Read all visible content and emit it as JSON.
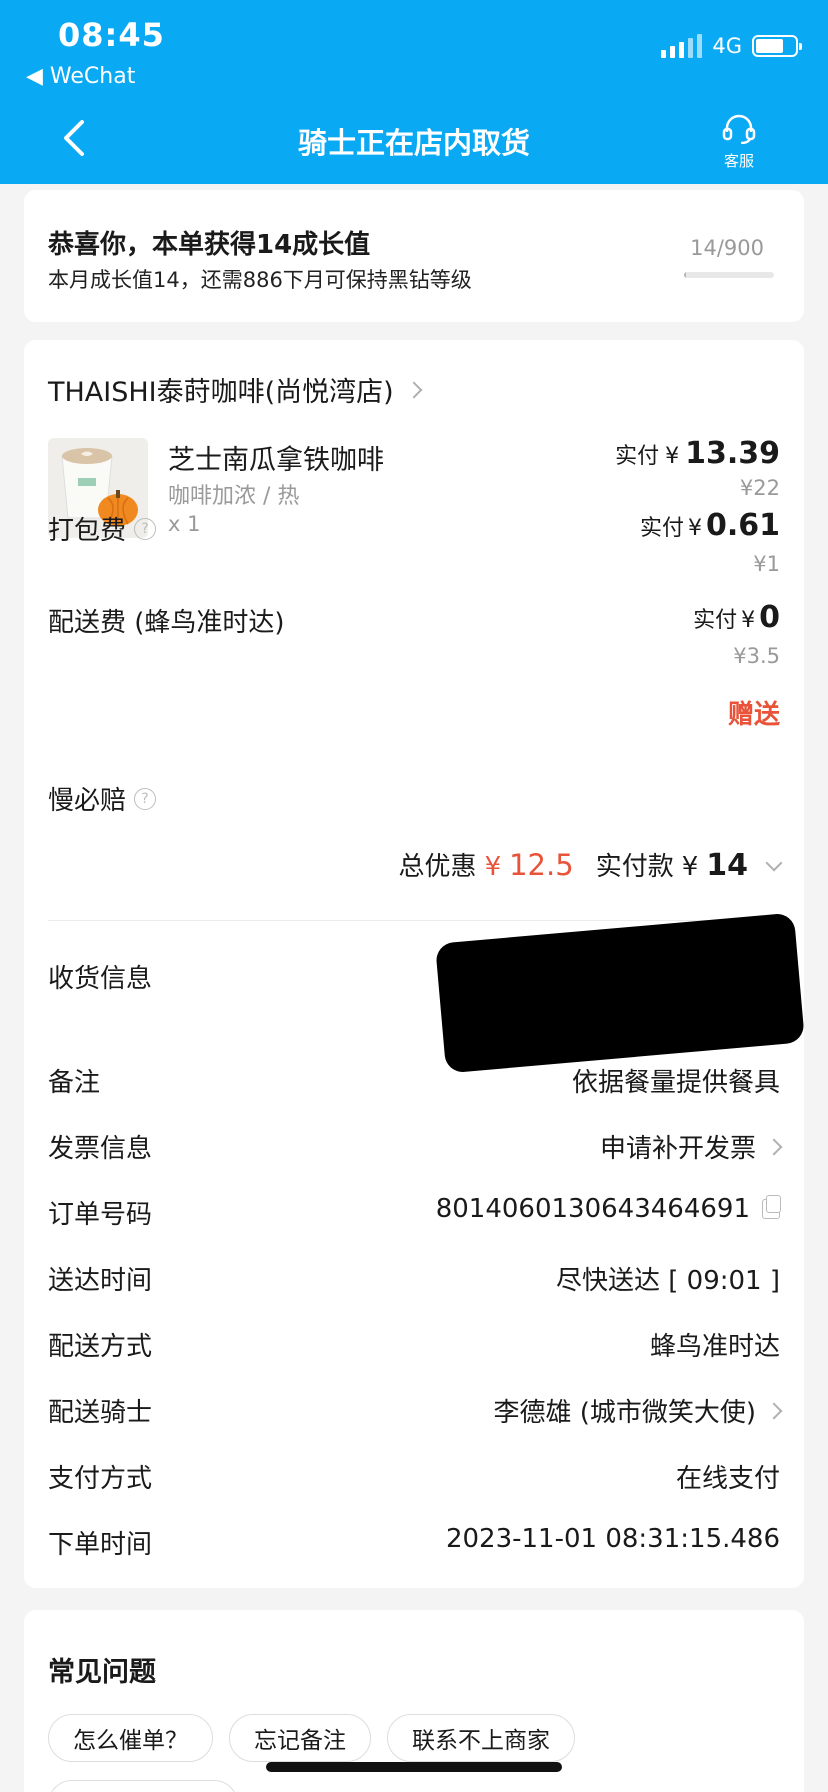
{
  "status_bar": {
    "time": "08:45",
    "back_app": "◀ WeChat",
    "network": "4G",
    "battery_level": 0.7
  },
  "nav": {
    "title": "骑士正在店内取货",
    "service_label": "客服"
  },
  "growth": {
    "title": "恭喜你，本单获得14成长值",
    "subtitle": "本月成长值14，还需886下月可保持黑钻等级",
    "count": "14/900",
    "progress": 0.0156
  },
  "order": {
    "store_name": "THAISHI泰莳咖啡(尚悦湾店)",
    "product": {
      "name": "芝士南瓜拿铁咖啡",
      "spec": "咖啡加浓 / 热",
      "qty": "x 1",
      "paid_label": "实付",
      "currency": "¥",
      "paid": "13.39",
      "original": "¥22"
    },
    "fees": [
      {
        "label": "打包费",
        "paid_label": "实付",
        "currency": "¥",
        "paid": "0.61",
        "original": "¥1"
      },
      {
        "label": "配送费 (蜂鸟准时达)",
        "paid_label": "实付",
        "currency": "¥",
        "paid": "0",
        "original": "¥3.5"
      }
    ],
    "slow_pay": {
      "label": "慢必赔",
      "value": "赠送"
    },
    "summary": {
      "discount_label": "总优惠",
      "discount_currency": "¥",
      "discount": "12.5",
      "total_label": "实付款",
      "total_currency": "¥",
      "total": "14"
    },
    "info": {
      "address_label": "收货信息",
      "remark_label": "备注",
      "remark_value": "依据餐量提供餐具",
      "invoice_label": "发票信息",
      "invoice_value": "申请补开发票",
      "order_no_label": "订单号码",
      "order_no_value": "8014060130643464691",
      "delivery_time_label": "送达时间",
      "delivery_time_value": "尽快送达 [ 09:01 ]",
      "delivery_method_label": "配送方式",
      "delivery_method_value": "蜂鸟准时达",
      "rider_label": "配送骑士",
      "rider_value": "李德雄 (城市微笑大使)",
      "payment_label": "支付方式",
      "payment_value": "在线支付",
      "order_time_label": "下单时间",
      "order_time_value": "2023-11-01 08:31:15.486"
    }
  },
  "faq": {
    "title": "常见问题",
    "chips": [
      "怎么催单？",
      "忘记备注",
      "联系不上商家"
    ]
  },
  "colors": {
    "header": "#0aa9f4",
    "accent_red": "#e8533a"
  }
}
